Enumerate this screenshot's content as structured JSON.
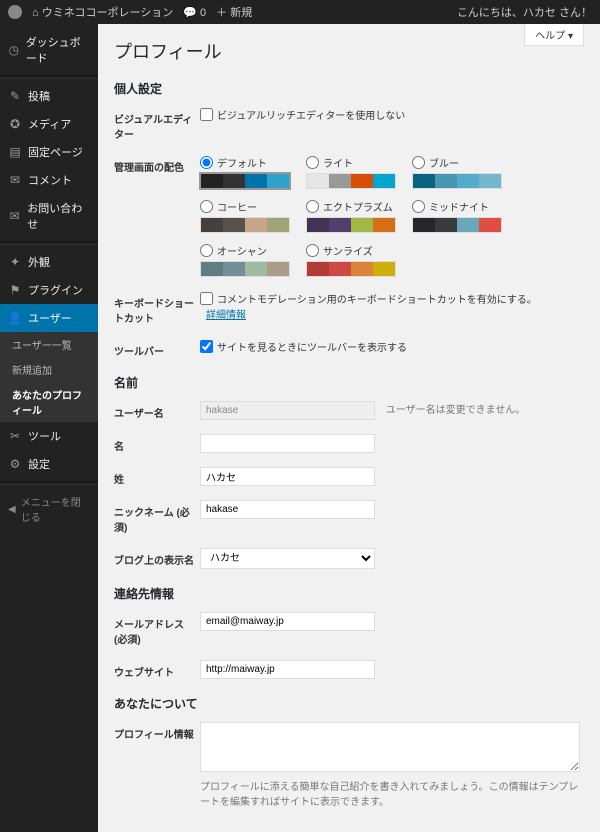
{
  "adminbar": {
    "site": "ウミネココーポレーション",
    "comments": "0",
    "new": "新規",
    "greeting": "こんにちは、ハカセ さん！"
  },
  "help": "ヘルプ ▾",
  "menu": {
    "dashboard": "ダッシュボード",
    "posts": "投稿",
    "media": "メディア",
    "pages": "固定ページ",
    "comments": "コメント",
    "contact": "お問い合わせ",
    "appearance": "外観",
    "plugins": "プラグイン",
    "users": "ユーザー",
    "users_sub": {
      "all": "ユーザー一覧",
      "add": "新規追加",
      "profile": "あなたのプロフィール"
    },
    "tools": "ツール",
    "settings": "設定",
    "collapse": "メニューを閉じる"
  },
  "page": {
    "title": "プロフィール",
    "h_personal": "個人設定",
    "h_name": "名前",
    "h_contact": "連絡先情報",
    "h_about": "あなたについて"
  },
  "labels": {
    "visual_editor": "ビジュアルエディター",
    "color_scheme": "管理画面の配色",
    "shortcuts": "キーボードショートカット",
    "toolbar": "ツールバー",
    "username": "ユーザー名",
    "first_name": "名",
    "last_name": "姓",
    "nickname": "ニックネーム (必須)",
    "display_name": "ブログ上の表示名",
    "email": "メールアドレス (必須)",
    "website": "ウェブサイト",
    "bio": "プロフィール情報"
  },
  "fields": {
    "visual_editor_cb": "ビジュアルリッチエディターを使用しない",
    "shortcuts_cb": "コメントモデレーション用のキーボードショートカットを有効にする。",
    "shortcuts_more": "詳細情報",
    "toolbar_cb": "サイトを見るときにツールバーを表示する",
    "username": "hakase",
    "username_desc": "ユーザー名は変更できません。",
    "last_name": "ハカセ",
    "nickname": "hakase",
    "display_name": "ハカセ",
    "email": "email@maiway.jp",
    "website": "http://maiway.jp",
    "bio_desc": "プロフィールに添える簡単な自己紹介を書き入れてみましょう。この情報はテンプレートを編集すればサイトに表示できます。"
  },
  "schemes": [
    {
      "name": "デフォルト",
      "selected": true,
      "colors": [
        "#222222",
        "#333333",
        "#0073aa",
        "#2ea2cc"
      ]
    },
    {
      "name": "ライト",
      "selected": false,
      "colors": [
        "#e5e5e5",
        "#999999",
        "#d64e07",
        "#04a4cc"
      ]
    },
    {
      "name": "ブルー",
      "selected": false,
      "colors": [
        "#096484",
        "#4796b3",
        "#52accc",
        "#74B6CE"
      ]
    },
    {
      "name": "コーヒー",
      "selected": false,
      "colors": [
        "#46403c",
        "#59524c",
        "#c7a589",
        "#9ea476"
      ]
    },
    {
      "name": "エクトプラズム",
      "selected": false,
      "colors": [
        "#413256",
        "#523f6d",
        "#a3b745",
        "#d46f15"
      ]
    },
    {
      "name": "ミッドナイト",
      "selected": false,
      "colors": [
        "#25282b",
        "#363b3f",
        "#69a8bb",
        "#e14d43"
      ]
    },
    {
      "name": "オーシャン",
      "selected": false,
      "colors": [
        "#627c83",
        "#738e96",
        "#9ebaa0",
        "#aa9d88"
      ]
    },
    {
      "name": "サンライズ",
      "selected": false,
      "colors": [
        "#b43c38",
        "#cf4944",
        "#dd823b",
        "#ccaf0b"
      ]
    }
  ]
}
